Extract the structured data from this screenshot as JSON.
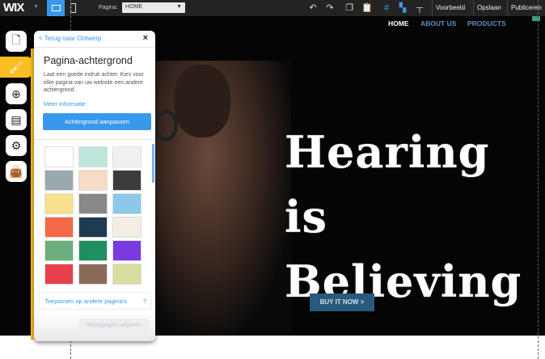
{
  "topbar": {
    "logo": "WIX",
    "page_label": "Pagina:",
    "page_value": "HOME",
    "preview": "Voorbeeld",
    "save": "Opslaan",
    "publish": "Publiceren",
    "accent": "#3899ec"
  },
  "site": {
    "nav": [
      {
        "label": "HOME"
      },
      {
        "label": "ABOUT US"
      },
      {
        "label": "PRODUCTS"
      }
    ],
    "headline_1": "Hearing is",
    "headline_2": "Believing",
    "cta": "BUY IT NOW >"
  },
  "sidebar": {
    "items": [
      {
        "icon": "page-icon"
      },
      {
        "icon": "paintbrush-icon",
        "active": true
      },
      {
        "icon": "add-icon"
      },
      {
        "icon": "store-icon"
      },
      {
        "icon": "gear-icon"
      },
      {
        "icon": "shopping-bag-icon"
      }
    ],
    "active_color": "#fbbd21"
  },
  "panel": {
    "back": "< Terug naar Ontwerp",
    "close": "×",
    "title": "Pagina-achtergrond",
    "description": "Laat een goede indruk achter. Kies voor elke pagina van uw website een andere achtergrond.",
    "more_info": "Meer informatie",
    "customize": "Achtergrond aanpassen",
    "apply_other": "Toepassen op andere pagina's",
    "help": "?",
    "discard": "Wijzigingen negeren",
    "swatches": [
      "#ffffff",
      "#bfe6dc",
      "#f0f0f0",
      "#9aa8b0",
      "#f6dcc4",
      "#3c3c3e",
      "#f7e08e",
      "#888888",
      "#8cc8ea",
      "#f26a47",
      "#1d3c4f",
      "#f3ede4",
      "#6cae7c",
      "#1e8f5e",
      "#7a3ae0",
      "#e8404a",
      "#8a6b58",
      "#d8dca0"
    ]
  }
}
